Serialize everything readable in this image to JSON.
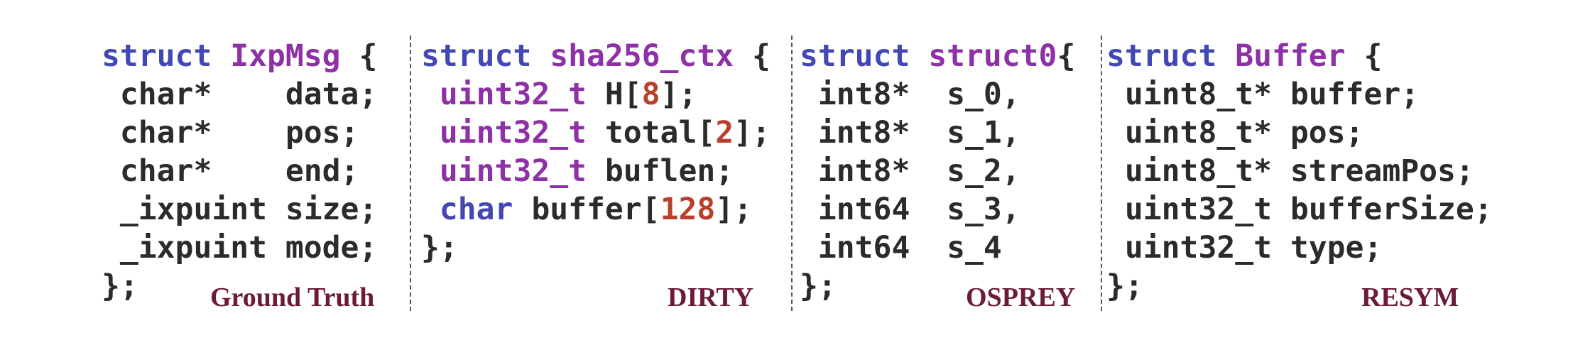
{
  "panels": [
    {
      "caption": "Ground Truth",
      "lines": [
        [
          {
            "t": "struct ",
            "c": "kw"
          },
          {
            "t": "IxpMsg",
            "c": "nm"
          },
          {
            "t": " {",
            "c": ""
          }
        ],
        [
          {
            "t": " char*    data;",
            "c": ""
          }
        ],
        [
          {
            "t": " char*    pos;",
            "c": ""
          }
        ],
        [
          {
            "t": " char*    end;",
            "c": ""
          }
        ],
        [
          {
            "t": " _ixpuint size;",
            "c": ""
          }
        ],
        [
          {
            "t": " _ixpuint mode;",
            "c": ""
          }
        ],
        [
          {
            "t": "};",
            "c": ""
          }
        ]
      ]
    },
    {
      "caption": "DIRTY",
      "lines": [
        [
          {
            "t": "struct ",
            "c": "kw"
          },
          {
            "t": "sha256_ctx",
            "c": "nm"
          },
          {
            "t": " {",
            "c": ""
          }
        ],
        [
          {
            "t": " ",
            "c": ""
          },
          {
            "t": "uint32_t",
            "c": "ty-p"
          },
          {
            "t": " H[",
            "c": ""
          },
          {
            "t": "8",
            "c": "num"
          },
          {
            "t": "];",
            "c": ""
          }
        ],
        [
          {
            "t": " ",
            "c": ""
          },
          {
            "t": "uint32_t",
            "c": "ty-p"
          },
          {
            "t": " total[",
            "c": ""
          },
          {
            "t": "2",
            "c": "num"
          },
          {
            "t": "];",
            "c": ""
          }
        ],
        [
          {
            "t": " ",
            "c": ""
          },
          {
            "t": "uint32_t",
            "c": "ty-p"
          },
          {
            "t": " buflen;",
            "c": ""
          }
        ],
        [
          {
            "t": " ",
            "c": ""
          },
          {
            "t": "char",
            "c": "ty-b"
          },
          {
            "t": " buffer[",
            "c": ""
          },
          {
            "t": "128",
            "c": "num"
          },
          {
            "t": "];",
            "c": ""
          }
        ],
        [
          {
            "t": "};",
            "c": ""
          }
        ]
      ]
    },
    {
      "caption": "OSPREY",
      "lines": [
        [
          {
            "t": "struct ",
            "c": "kw"
          },
          {
            "t": "struct0",
            "c": "nm"
          },
          {
            "t": "{",
            "c": ""
          }
        ],
        [
          {
            "t": " int8*  s_0,",
            "c": ""
          }
        ],
        [
          {
            "t": " int8*  s_1,",
            "c": ""
          }
        ],
        [
          {
            "t": " int8*  s_2,",
            "c": ""
          }
        ],
        [
          {
            "t": " int64  s_3,",
            "c": ""
          }
        ],
        [
          {
            "t": " int64  s_4",
            "c": ""
          }
        ],
        [
          {
            "t": "};",
            "c": ""
          }
        ]
      ]
    },
    {
      "caption": "RESYM",
      "lines": [
        [
          {
            "t": "struct ",
            "c": "kw"
          },
          {
            "t": "Buffer",
            "c": "nm"
          },
          {
            "t": " {",
            "c": ""
          }
        ],
        [
          {
            "t": " uint8_t* buffer;",
            "c": ""
          }
        ],
        [
          {
            "t": " uint8_t* pos;",
            "c": ""
          }
        ],
        [
          {
            "t": " uint8_t* streamPos;",
            "c": ""
          }
        ],
        [
          {
            "t": " uint32_t bufferSize;",
            "c": ""
          }
        ],
        [
          {
            "t": " uint32_t type;",
            "c": ""
          }
        ],
        [
          {
            "t": "};",
            "c": ""
          }
        ]
      ]
    }
  ]
}
